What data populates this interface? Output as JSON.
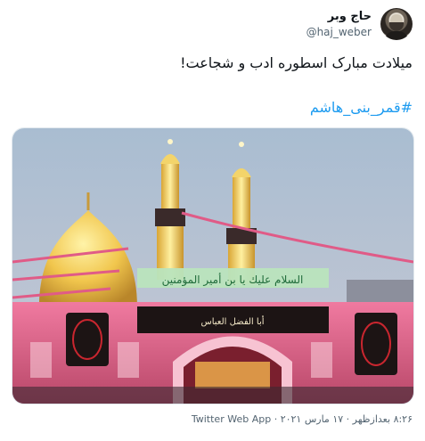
{
  "tweet": {
    "author_name": "حاج وبر",
    "author_handle": "@haj_weber",
    "text": "میلادت مبارک اسطوره ادب و شجاعت!",
    "hashtag": "#قمر_بنی_هاشم",
    "image": {
      "banner_text": "السلام عليك يا بن أمير المؤمنين",
      "inscription_text": "أبا الفضل العباس"
    },
    "meta": {
      "timestamp": "۸:۲۶ بعدازظهر · ۱۷ مارس ۲۰۲۱",
      "separator": " · ",
      "source": "Twitter Web App"
    }
  },
  "colors": {
    "link": "#1d9bf0",
    "text": "#0f1419",
    "muted": "#536471",
    "sky": "#9fb3c8",
    "dome_gold": "#f1c64d",
    "wall_pink": "#e46b8f",
    "banner_green": "#9ad3a3"
  }
}
